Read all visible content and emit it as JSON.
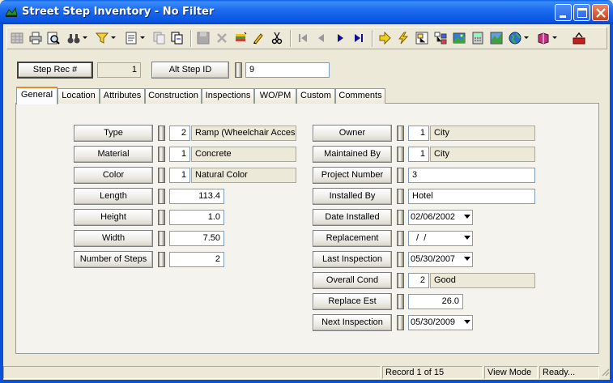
{
  "window": {
    "title": "Street Step Inventory - No Filter"
  },
  "header": {
    "rec_button": "Step Rec #",
    "rec_value": "1",
    "alt_button": "Alt Step ID",
    "alt_value": "9"
  },
  "tabs": [
    "General",
    "Location",
    "Attributes",
    "Construction",
    "Inspections",
    "WO/PM",
    "Custom",
    "Comments"
  ],
  "left": {
    "type": {
      "label": "Type",
      "code": "2",
      "desc": "Ramp (Wheelchair Acces"
    },
    "material": {
      "label": "Material",
      "code": "1",
      "desc": "Concrete"
    },
    "color": {
      "label": "Color",
      "code": "1",
      "desc": "Natural Color"
    },
    "length": {
      "label": "Length",
      "value": "113.4"
    },
    "height": {
      "label": "Height",
      "value": "1.0"
    },
    "width": {
      "label": "Width",
      "value": "7.50"
    },
    "steps": {
      "label": "Number of Steps",
      "value": "2"
    }
  },
  "right": {
    "owner": {
      "label": "Owner",
      "code": "1",
      "desc": "City"
    },
    "maintained": {
      "label": "Maintained By",
      "code": "1",
      "desc": "City"
    },
    "project": {
      "label": "Project Number",
      "value": "3"
    },
    "installed_by": {
      "label": "Installed By",
      "value": "Hotel"
    },
    "date_installed": {
      "label": "Date Installed",
      "value": "02/06/2002"
    },
    "replacement": {
      "label": "Replacement",
      "value": " /  /"
    },
    "last_insp": {
      "label": "Last Inspection",
      "value": "05/30/2007"
    },
    "overall": {
      "label": "Overall Cond",
      "code": "2",
      "desc": "Good"
    },
    "replace_est": {
      "label": "Replace Est",
      "value": "26.0"
    },
    "next_insp": {
      "label": "Next Inspection",
      "value": "05/30/2009"
    }
  },
  "status": {
    "record": "Record 1 of 15",
    "mode": "View Mode",
    "ready": "Ready..."
  },
  "colors": {
    "titlebar": "#0a5ee8",
    "face": "#ece9d8",
    "active_tab": "#e68b2c"
  }
}
